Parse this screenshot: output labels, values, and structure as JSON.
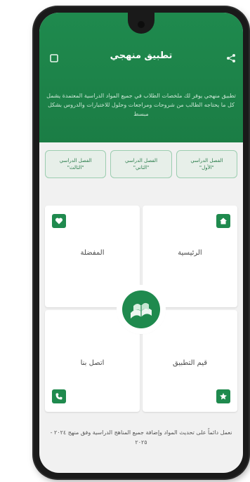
{
  "app": {
    "title": "تطبيق منهجي"
  },
  "header": {
    "description": "تطبيق منهجي يوفر لك ملخصات الطلاب في جميع المواد الدراسية المعتمدة يشمل كل ما يحتاجه الطالب من شروحات ومراجعات وحلول للاختبارات والدروس بشكل مبسط",
    "left_icon": "square-icon",
    "right_icon": "share-icon"
  },
  "semesters": [
    {
      "label": "الفصل الدراسي\n\"الأول\""
    },
    {
      "label": "الفصل الدراسي\n\"الثاني\""
    },
    {
      "label": "الفصل الدراسي\n\"الثالث\""
    }
  ],
  "tiles": {
    "home": {
      "label": "الرئيسية",
      "icon": "home-icon"
    },
    "favorites": {
      "label": "المفضلة",
      "icon": "heart-icon"
    },
    "rate": {
      "label": "قيم التطبيق",
      "icon": "star-icon"
    },
    "contact": {
      "label": "اتصل بنا",
      "icon": "phone-icon"
    }
  },
  "footer": {
    "text": "نعمل دائماً على تحديث المواد وإضافة جميع المناهج الدراسية وفق منهج ٢٠٢٤ - ٢٠٢٥"
  },
  "colors": {
    "brand_green": "#1f8a4e",
    "tile_bg": "#ffffff",
    "chip_bg": "#e7efe9"
  }
}
